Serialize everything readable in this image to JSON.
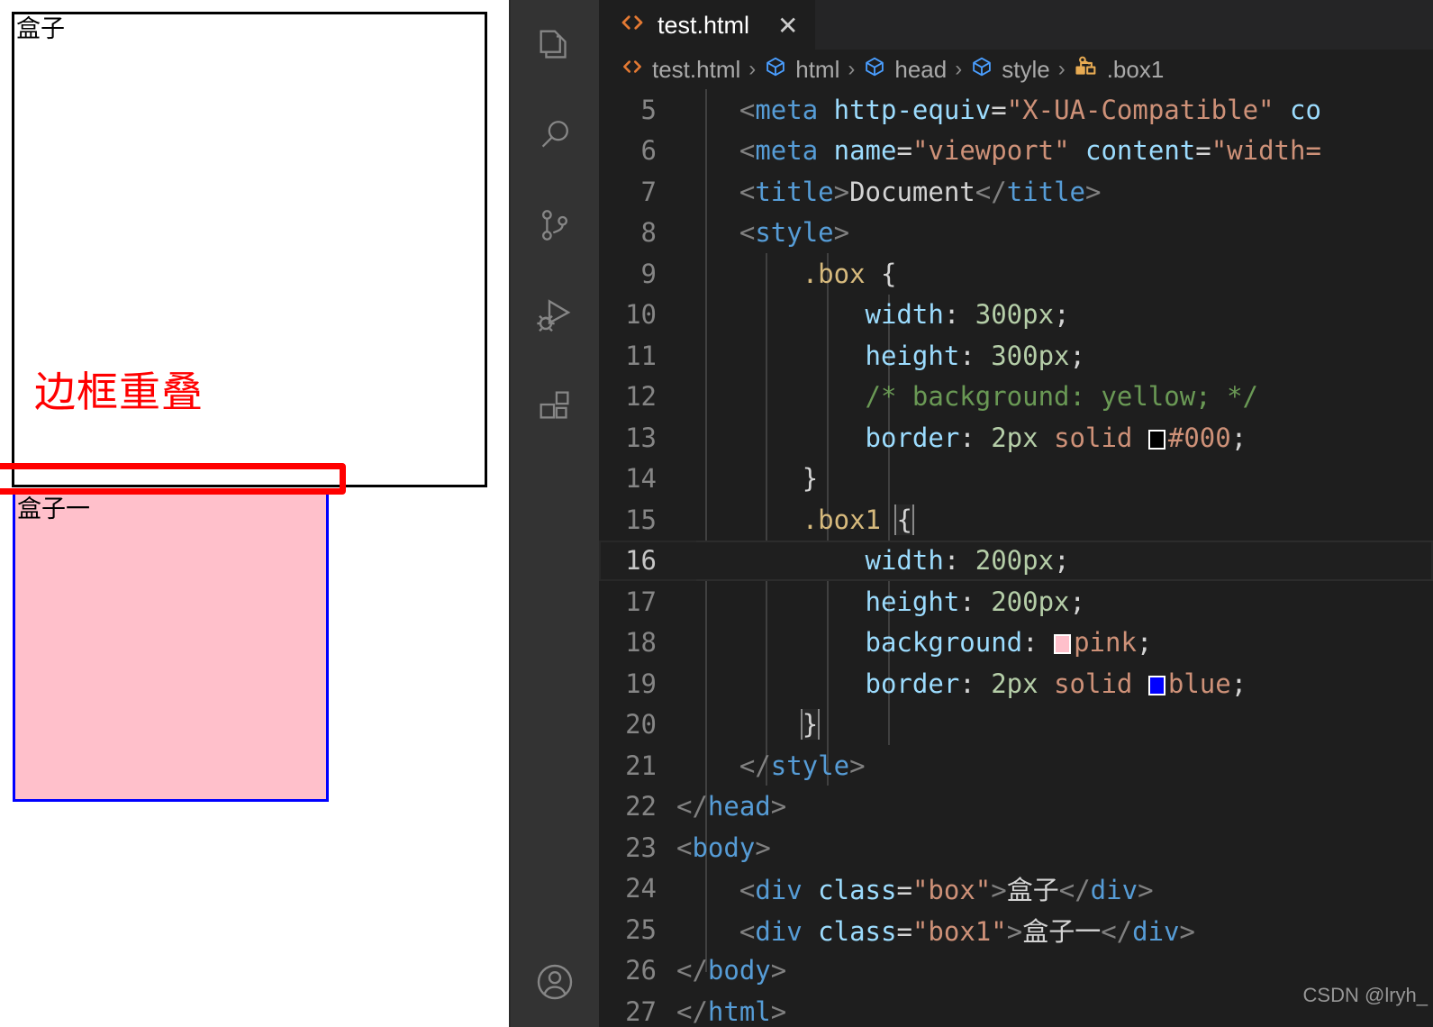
{
  "preview": {
    "box_black_label": "盒子",
    "box_pink_label": "盒子一",
    "annotation_text": "边框重叠",
    "colors": {
      "black_border": "#000000",
      "blue_border": "#0000ff",
      "pink_fill": "#ffc0cb",
      "annotation_red": "#ff0000"
    }
  },
  "activity_bar": {
    "items": [
      {
        "name": "explorer",
        "icon": "files-icon"
      },
      {
        "name": "search",
        "icon": "search-icon"
      },
      {
        "name": "source-control",
        "icon": "source-control-icon"
      },
      {
        "name": "run-debug",
        "icon": "run-debug-icon"
      },
      {
        "name": "extensions",
        "icon": "extensions-icon"
      }
    ],
    "bottom": [
      {
        "name": "accounts",
        "icon": "account-icon"
      }
    ]
  },
  "tab": {
    "title": "test.html",
    "icon": "html-file-icon",
    "close_label": "✕"
  },
  "breadcrumbs": {
    "separator": "›",
    "items": [
      {
        "label": "test.html",
        "icon": "html-file-icon"
      },
      {
        "label": "html",
        "icon": "cube-icon"
      },
      {
        "label": "head",
        "icon": "cube-icon"
      },
      {
        "label": "style",
        "icon": "cube-icon"
      },
      {
        "label": ".box1",
        "icon": "css-rule-icon"
      }
    ]
  },
  "editor": {
    "active_line": 16,
    "first_visible_line": 5,
    "lines": [
      {
        "n": 5,
        "text": "    <meta http-equiv=\"X-UA-Compatible\" co"
      },
      {
        "n": 6,
        "text": "    <meta name=\"viewport\" content=\"width="
      },
      {
        "n": 7,
        "text": "    <title>Document</title>"
      },
      {
        "n": 8,
        "text": "    <style>"
      },
      {
        "n": 9,
        "text": "        .box {"
      },
      {
        "n": 10,
        "text": "            width: 300px;"
      },
      {
        "n": 11,
        "text": "            height: 300px;"
      },
      {
        "n": 12,
        "text": "            /* background: yellow; */"
      },
      {
        "n": 13,
        "text": "            border: 2px solid #000;"
      },
      {
        "n": 14,
        "text": "        }"
      },
      {
        "n": 15,
        "text": "        .box1 {"
      },
      {
        "n": 16,
        "text": "            width: 200px;"
      },
      {
        "n": 17,
        "text": "            height: 200px;"
      },
      {
        "n": 18,
        "text": "            background: pink;"
      },
      {
        "n": 19,
        "text": "            border: 2px solid blue;"
      },
      {
        "n": 20,
        "text": "        }"
      },
      {
        "n": 21,
        "text": "    </style>"
      },
      {
        "n": 22,
        "text": "</head>"
      },
      {
        "n": 23,
        "text": "<body>"
      },
      {
        "n": 24,
        "text": "    <div class=\"box\">盒子</div>"
      },
      {
        "n": 25,
        "text": "    <div class=\"box1\">盒子一</div>"
      },
      {
        "n": 26,
        "text": "</body>"
      },
      {
        "n": 27,
        "text": "</html>"
      }
    ],
    "color_swatches": {
      "line13": "#000000",
      "line18": "#ffc0cb",
      "line19": "#0000ff"
    }
  },
  "watermark": "CSDN @lryh_",
  "code_line_numbers": {
    "l5": "5",
    "l6": "6",
    "l7": "7",
    "l8": "8",
    "l9": "9",
    "l10": "10",
    "l11": "11",
    "l12": "12",
    "l13": "13",
    "l14": "14",
    "l15": "15",
    "l16": "16",
    "l17": "17",
    "l18": "18",
    "l19": "19",
    "l20": "20",
    "l21": "21",
    "l22": "22",
    "l23": "23",
    "l24": "24",
    "l25": "25",
    "l26": "26",
    "l27": "27"
  },
  "code_tokens": {
    "l5": {
      "lt": "<",
      "tag": "meta",
      "sp": " ",
      "attr": "http-equiv",
      "eq": "=",
      "str": "\"X-UA-Compatible\"",
      "attr2": " co"
    },
    "l6": {
      "lt": "<",
      "tag": "meta",
      "attr": "name",
      "str": "\"viewport\"",
      "attr2": "content",
      "str2": "\"width="
    },
    "l7": {
      "open": "<title>",
      "text": "Document",
      "close": "</title>"
    },
    "l8": {
      "open": "<style>"
    },
    "l9": {
      "sel": ".box",
      "brace": "{"
    },
    "l10": {
      "prop": "width",
      "colon": ":",
      "num": "300px",
      "semi": ";"
    },
    "l11": {
      "prop": "height",
      "colon": ":",
      "num": "300px",
      "semi": ";"
    },
    "l12": {
      "comment": "/* background: yellow; */"
    },
    "l13": {
      "prop": "border",
      "colon": ":",
      "num": "2px",
      "val": "solid",
      "color": "#000",
      "semi": ";"
    },
    "l14": {
      "brace": "}"
    },
    "l15": {
      "sel": ".box1",
      "brace": "{"
    },
    "l16": {
      "prop": "width",
      "colon": ":",
      "num": "200px",
      "semi": ";"
    },
    "l17": {
      "prop": "height",
      "colon": ":",
      "num": "200px",
      "semi": ";"
    },
    "l18": {
      "prop": "background",
      "colon": ":",
      "val": "pink",
      "semi": ";"
    },
    "l19": {
      "prop": "border",
      "colon": ":",
      "num": "2px",
      "val": "solid",
      "color": "blue",
      "semi": ";"
    },
    "l20": {
      "brace": "}"
    },
    "l21": {
      "close": "</style>"
    },
    "l22": {
      "close": "</head>"
    },
    "l23": {
      "open": "<body>"
    },
    "l24": {
      "lt": "<",
      "tag": "div",
      "attr": "class",
      "str": "\"box\"",
      "gt": ">",
      "text": "盒子",
      "close": "</div>"
    },
    "l25": {
      "lt": "<",
      "tag": "div",
      "attr": "class",
      "str": "\"box1\"",
      "gt": ">",
      "text": "盒子一",
      "close": "</div>"
    },
    "l26": {
      "close": "</body>"
    },
    "l27": {
      "close": "</html>"
    }
  }
}
